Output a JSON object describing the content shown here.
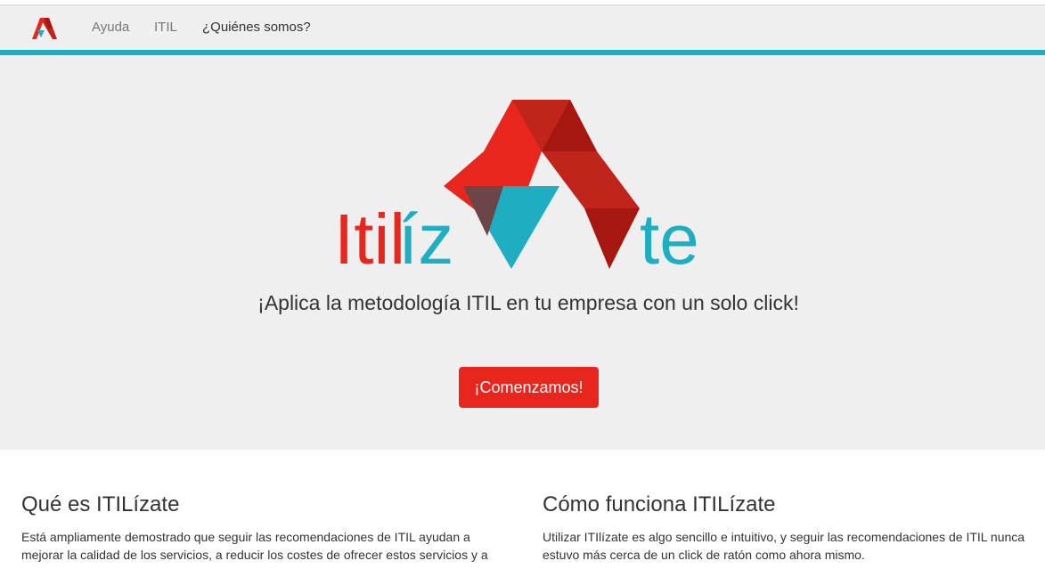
{
  "navbar": {
    "brand_icon": "itilizate-logo-icon",
    "links": [
      "Ayuda",
      "ITIL",
      "¿Quiénes somos?"
    ]
  },
  "hero": {
    "logo": {
      "part_red": "Itil",
      "part_blue": "íz",
      "part_end": "te"
    },
    "tagline": "¡Aplica la metodología ITIL en tu empresa con un solo click!",
    "cta_label": "¡Comenzamos!"
  },
  "sections": [
    {
      "title": "Qué es ITILízate",
      "text": "Está ampliamente demostrado que seguir las recomendaciones de ITIL ayudan a mejorar la calidad de los servicios, a reducir los costes de ofrecer estos servicios y a"
    },
    {
      "title": "Cómo funciona ITILízate",
      "text": "Utilizar ITIlízate es algo sencillo e intuitivo, y seguir las recomendaciones de ITIL nunca estuvo más cerca de un click de ratón como ahora mismo."
    }
  ],
  "colors": {
    "accent_red": "#e8261d",
    "accent_blue": "#1fadc2",
    "dark_red": "#a5170f",
    "background": "#efefef"
  }
}
